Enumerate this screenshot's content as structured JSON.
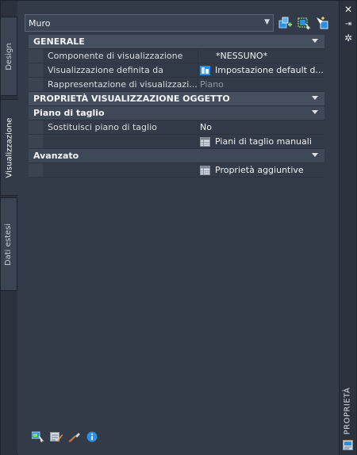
{
  "left_tabs": [
    {
      "label": "Design",
      "active": false
    },
    {
      "label": "Visualizzazione",
      "active": true
    },
    {
      "label": "Dati estesi",
      "active": false
    }
  ],
  "right_strip": {
    "title": "PROPRIETÀ",
    "close_glyph": "✕",
    "autohide_glyph": "⇥",
    "settings_glyph": "✲"
  },
  "selector": {
    "value": "Muro",
    "arrow_glyph": "▾"
  },
  "top_toolbar": [
    "add-selection-icon",
    "quick-select-icon",
    "toggle-pickadd-icon"
  ],
  "sections": {
    "generale": {
      "title": "GENERALE",
      "rows": [
        {
          "name": "Componente di visualizzazione",
          "value": "*NESSUNO*"
        },
        {
          "name": "Visualizzazione definita da",
          "value": "Impostazione default d..."
        },
        {
          "name": "Rappresentazione di visualizzazi...",
          "value": "Piano"
        }
      ]
    },
    "proprieta": {
      "title": "PROPRIETÀ VISUALIZZAZIONE OGGETTO",
      "piano": {
        "title": "Piano di taglio",
        "rows": [
          {
            "name": "Sostituisci piano di taglio",
            "value": "No"
          },
          {
            "name": "",
            "value": "Piani di taglio manuali"
          }
        ]
      },
      "avanzato": {
        "title": "Avanzato",
        "rows": [
          {
            "name": "",
            "value": "Proprietà aggiuntive"
          }
        ]
      }
    }
  },
  "bottom_toolbar": [
    "select-objects-icon",
    "edit-style-icon",
    "match-properties-icon",
    "info-icon"
  ],
  "colors": {
    "panel": "#333b48",
    "category": "#454f5e",
    "accent": "#2d8fe0"
  }
}
